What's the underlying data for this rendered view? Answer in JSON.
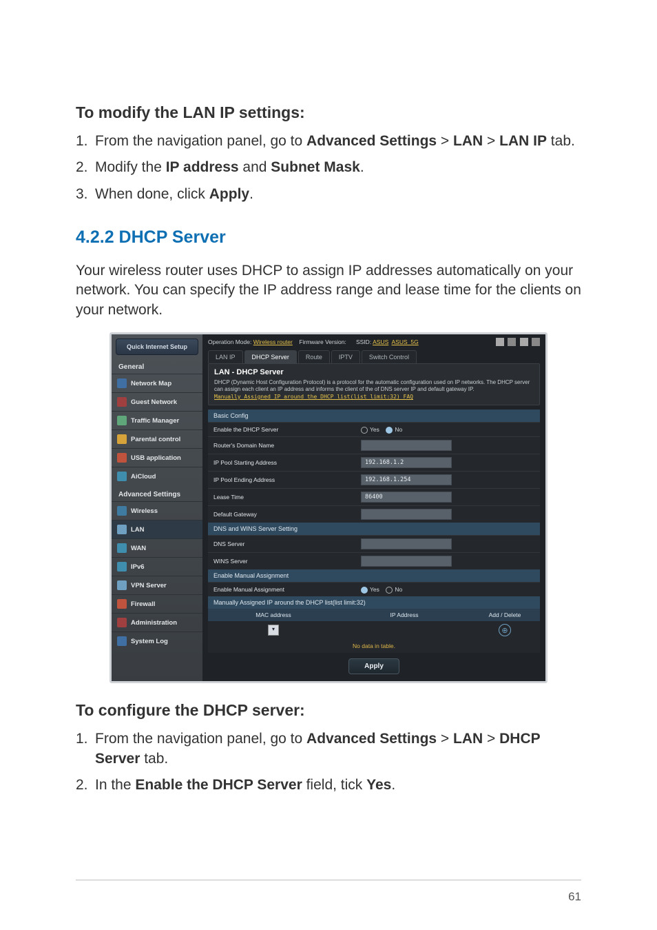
{
  "page_number": "61",
  "section1": {
    "heading": "To modify the LAN IP settings:",
    "steps": [
      {
        "pre": "From the navigation panel, go to ",
        "b1": "Advanced Settings",
        "sep1": " > ",
        "b2": "LAN",
        "sep2": " > ",
        "b3": "LAN IP",
        "post": " tab."
      },
      {
        "pre": "Modify the ",
        "b1": "IP address",
        "sep1": " and ",
        "b2": "Subnet Mask",
        "post": "."
      },
      {
        "pre": "When done, click ",
        "b1": "Apply",
        "post": "."
      }
    ]
  },
  "section2": {
    "title": "4.2.2 DHCP Server",
    "para": "Your wireless router uses DHCP to assign IP addresses automatically on your network. You can specify the IP address range and lease time for the clients on your network."
  },
  "section3": {
    "heading": "To configure the DHCP server:",
    "steps": [
      {
        "pre": "From the navigation panel, go to ",
        "b1": "Advanced Settings",
        "sep1": " > ",
        "b2": "LAN",
        "sep2": " > ",
        "b3": "DHCP Server",
        "post": " tab."
      },
      {
        "pre": "In the ",
        "b1": "Enable the DHCP Server",
        "mid": " field, tick ",
        "b2": "Yes",
        "post": "."
      }
    ]
  },
  "router": {
    "topbar": {
      "opmode_label": "Operation Mode:",
      "opmode_value": "Wireless router",
      "fw_label": "Firmware Version:",
      "ssid_label": "SSID:",
      "ssid1": "ASUS",
      "ssid2": "ASUS_5G"
    },
    "sidebar": {
      "quick": "Quick Internet Setup",
      "general": "General",
      "items_general": [
        "Network Map",
        "Guest Network",
        "Traffic Manager",
        "Parental control",
        "USB application",
        "AiCloud"
      ],
      "advanced": "Advanced Settings",
      "items_advanced": [
        "Wireless",
        "LAN",
        "WAN",
        "IPv6",
        "VPN Server",
        "Firewall",
        "Administration",
        "System Log"
      ]
    },
    "tabs": [
      "LAN IP",
      "DHCP Server",
      "Route",
      "IPTV",
      "Switch Control"
    ],
    "panel": {
      "title": "LAN - DHCP Server",
      "desc1": "DHCP (Dynamic Host Configuration Protocol) is a protocol for the automatic configuration used on IP networks. The DHCP server can assign each client an IP address and informs the client of the of DNS server IP and default gateway IP.",
      "desc_link": "Manually Assigned IP around the DHCP list(list limit:32) FAQ"
    },
    "sections": {
      "basic": "Basic Config",
      "dns": "DNS and WINS Server Setting",
      "manual": "Enable Manual Assignment",
      "manual_list": "Manually Assigned IP around the DHCP list(list limit:32)"
    },
    "fields": {
      "enable_dhcp": {
        "label": "Enable the DHCP Server",
        "yes": "Yes",
        "no": "No"
      },
      "domain": {
        "label": "Router's Domain Name",
        "value": ""
      },
      "pool_start": {
        "label": "IP Pool Starting Address",
        "value": "192.168.1.2"
      },
      "pool_end": {
        "label": "IP Pool Ending Address",
        "value": "192.168.1.254"
      },
      "lease": {
        "label": "Lease Time",
        "value": "86400"
      },
      "gateway": {
        "label": "Default Gateway",
        "value": ""
      },
      "dns_server": {
        "label": "DNS Server",
        "value": ""
      },
      "wins_server": {
        "label": "WINS Server",
        "value": ""
      },
      "enable_manual": {
        "label": "Enable Manual Assignment",
        "yes": "Yes",
        "no": "No"
      }
    },
    "table": {
      "col_mac": "MAC address",
      "col_ip": "IP Address",
      "col_action": "Add / Delete",
      "nodata": "No data in table."
    },
    "apply": "Apply"
  }
}
